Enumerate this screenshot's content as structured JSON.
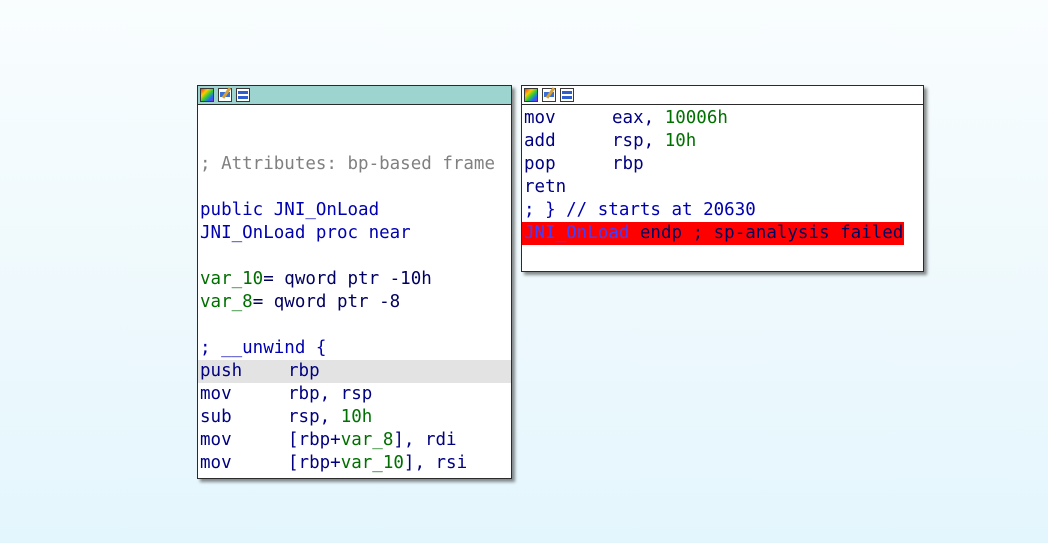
{
  "left_node": {
    "lines": [
      {
        "type": "blank"
      },
      {
        "type": "blank"
      },
      {
        "type": "comment",
        "text": "; Attributes: bp-based frame"
      },
      {
        "type": "blank"
      },
      {
        "type": "decl",
        "text": "public JNI_OnLoad"
      },
      {
        "type": "decl",
        "text": "JNI_OnLoad proc near"
      },
      {
        "type": "blank"
      },
      {
        "type": "var",
        "name": "var_10",
        "rest": "= qword ptr -10h"
      },
      {
        "type": "var",
        "name": "var_8",
        "rest": "= qword ptr -8"
      },
      {
        "type": "blank"
      },
      {
        "type": "decl",
        "text": "; __unwind {"
      },
      {
        "type": "insn",
        "mnem": "push",
        "ops": "rbp",
        "highlight": true
      },
      {
        "type": "insn",
        "mnem": "mov",
        "ops": "rbp, rsp"
      },
      {
        "type": "insn",
        "mnem": "sub",
        "ops": "rsp, ",
        "num": "10h"
      },
      {
        "type": "insn",
        "mnem": "mov",
        "ops": "[rbp+",
        "var": "var_8",
        "ops2": "], rdi"
      },
      {
        "type": "insn",
        "mnem": "mov",
        "ops": "[rbp+",
        "var": "var_10",
        "ops2": "], rsi"
      }
    ]
  },
  "right_node": {
    "lines": [
      {
        "type": "insn",
        "mnem": "mov",
        "ops": "eax, ",
        "num": "10006h"
      },
      {
        "type": "insn",
        "mnem": "add",
        "ops": "rsp, ",
        "num": "10h"
      },
      {
        "type": "insn",
        "mnem": "pop",
        "ops": "rbp"
      },
      {
        "type": "insn",
        "mnem": "retn",
        "ops": ""
      },
      {
        "type": "decl",
        "text": "; } // starts at 20630"
      },
      {
        "type": "failed",
        "fname": "JNI_OnLoad",
        "rest": " endp ; sp-analysis failed"
      }
    ]
  },
  "colors": {
    "left_titlebar": "#9dd4cf",
    "failed_highlight": "#ff0000",
    "instruction_highlight": "#e3e3e3"
  },
  "icons": [
    "color-palette-icon",
    "rename-pencil-icon",
    "graph-overview-icon"
  ]
}
